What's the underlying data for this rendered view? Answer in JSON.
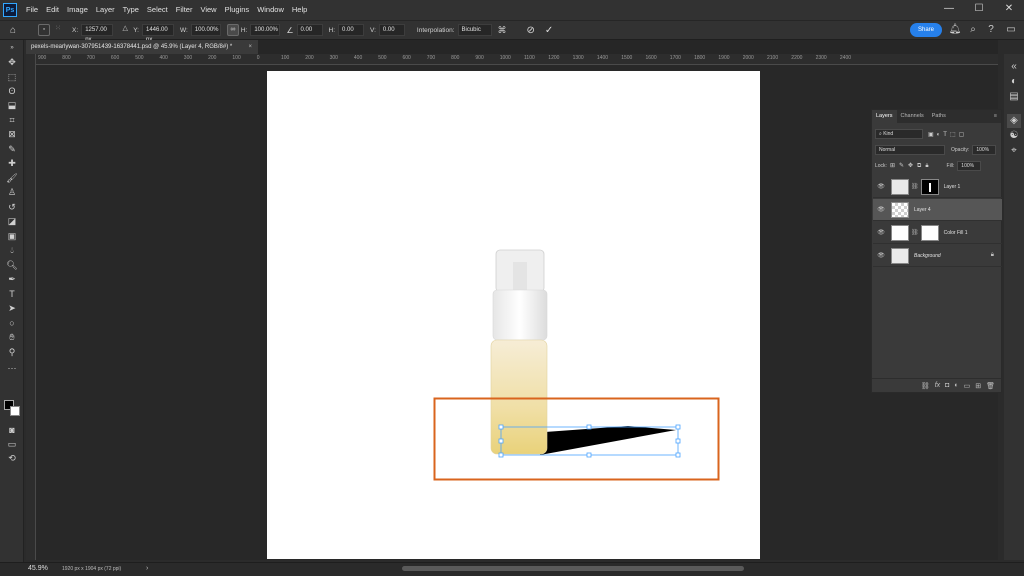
{
  "app": {
    "logo": "Ps",
    "menu": [
      "File",
      "Edit",
      "Image",
      "Layer",
      "Type",
      "Select",
      "Filter",
      "View",
      "Plugins",
      "Window",
      "Help"
    ],
    "window_controls": [
      "—",
      "☐",
      "✕"
    ]
  },
  "options": {
    "x_label": "X:",
    "x_value": "1257.00 px",
    "y_label": "Y:",
    "y_value": "1446.00 px",
    "w_label": "W:",
    "w_value": "100.00%",
    "h_label": "H:",
    "h_value": "100.00%",
    "angle_value": "0.00",
    "hskew_label": "H:",
    "hskew_value": "0.00",
    "vskew_label": "V:",
    "vskew_value": "0.00",
    "interp_label": "Interpolation:",
    "interp_value": "Bicubic",
    "share_label": "Share"
  },
  "document": {
    "tab_title": "pexels-mearlywan-307951439-16378441.psd @ 45.9% (Layer 4, RGB/8#) *",
    "tab_close": "×"
  },
  "ruler": {
    "h_ticks": [
      "900",
      "800",
      "700",
      "600",
      "500",
      "400",
      "300",
      "200",
      "100",
      "0",
      "100",
      "200",
      "300",
      "400",
      "500",
      "600",
      "700",
      "800",
      "900",
      "1000",
      "1100",
      "1200",
      "1300",
      "1400",
      "1500",
      "1600",
      "1700",
      "1800",
      "1900",
      "2000",
      "2100",
      "2200",
      "2300",
      "2400"
    ]
  },
  "layers_panel": {
    "tabs": [
      "Layers",
      "Channels",
      "Paths"
    ],
    "filter_label": "Kind",
    "blend_mode": "Normal",
    "opacity_label": "Opacity:",
    "opacity_value": "100%",
    "lock_label": "Lock:",
    "fill_label": "Fill:",
    "fill_value": "100%",
    "layers": [
      {
        "name": "Layer 1",
        "selected": false,
        "has_mask": true
      },
      {
        "name": "Layer 4",
        "selected": true,
        "has_mask": false
      },
      {
        "name": "Color Fill 1",
        "selected": false,
        "has_mask": true
      },
      {
        "name": "Background",
        "selected": false,
        "has_mask": false,
        "locked": true
      }
    ],
    "footer_icons": [
      "link-icon",
      "fx-icon",
      "mask-icon",
      "adjustment-icon",
      "group-icon",
      "new-layer-icon",
      "trash-icon"
    ]
  },
  "status": {
    "zoom": "45.9%",
    "dimensions": "1920 px x 1904 px (72 ppi)",
    "arrow": "›"
  },
  "colors": {
    "accent": "#2680eb",
    "highlight_box": "#d9641e",
    "transform_box": "#4aa3ff"
  }
}
